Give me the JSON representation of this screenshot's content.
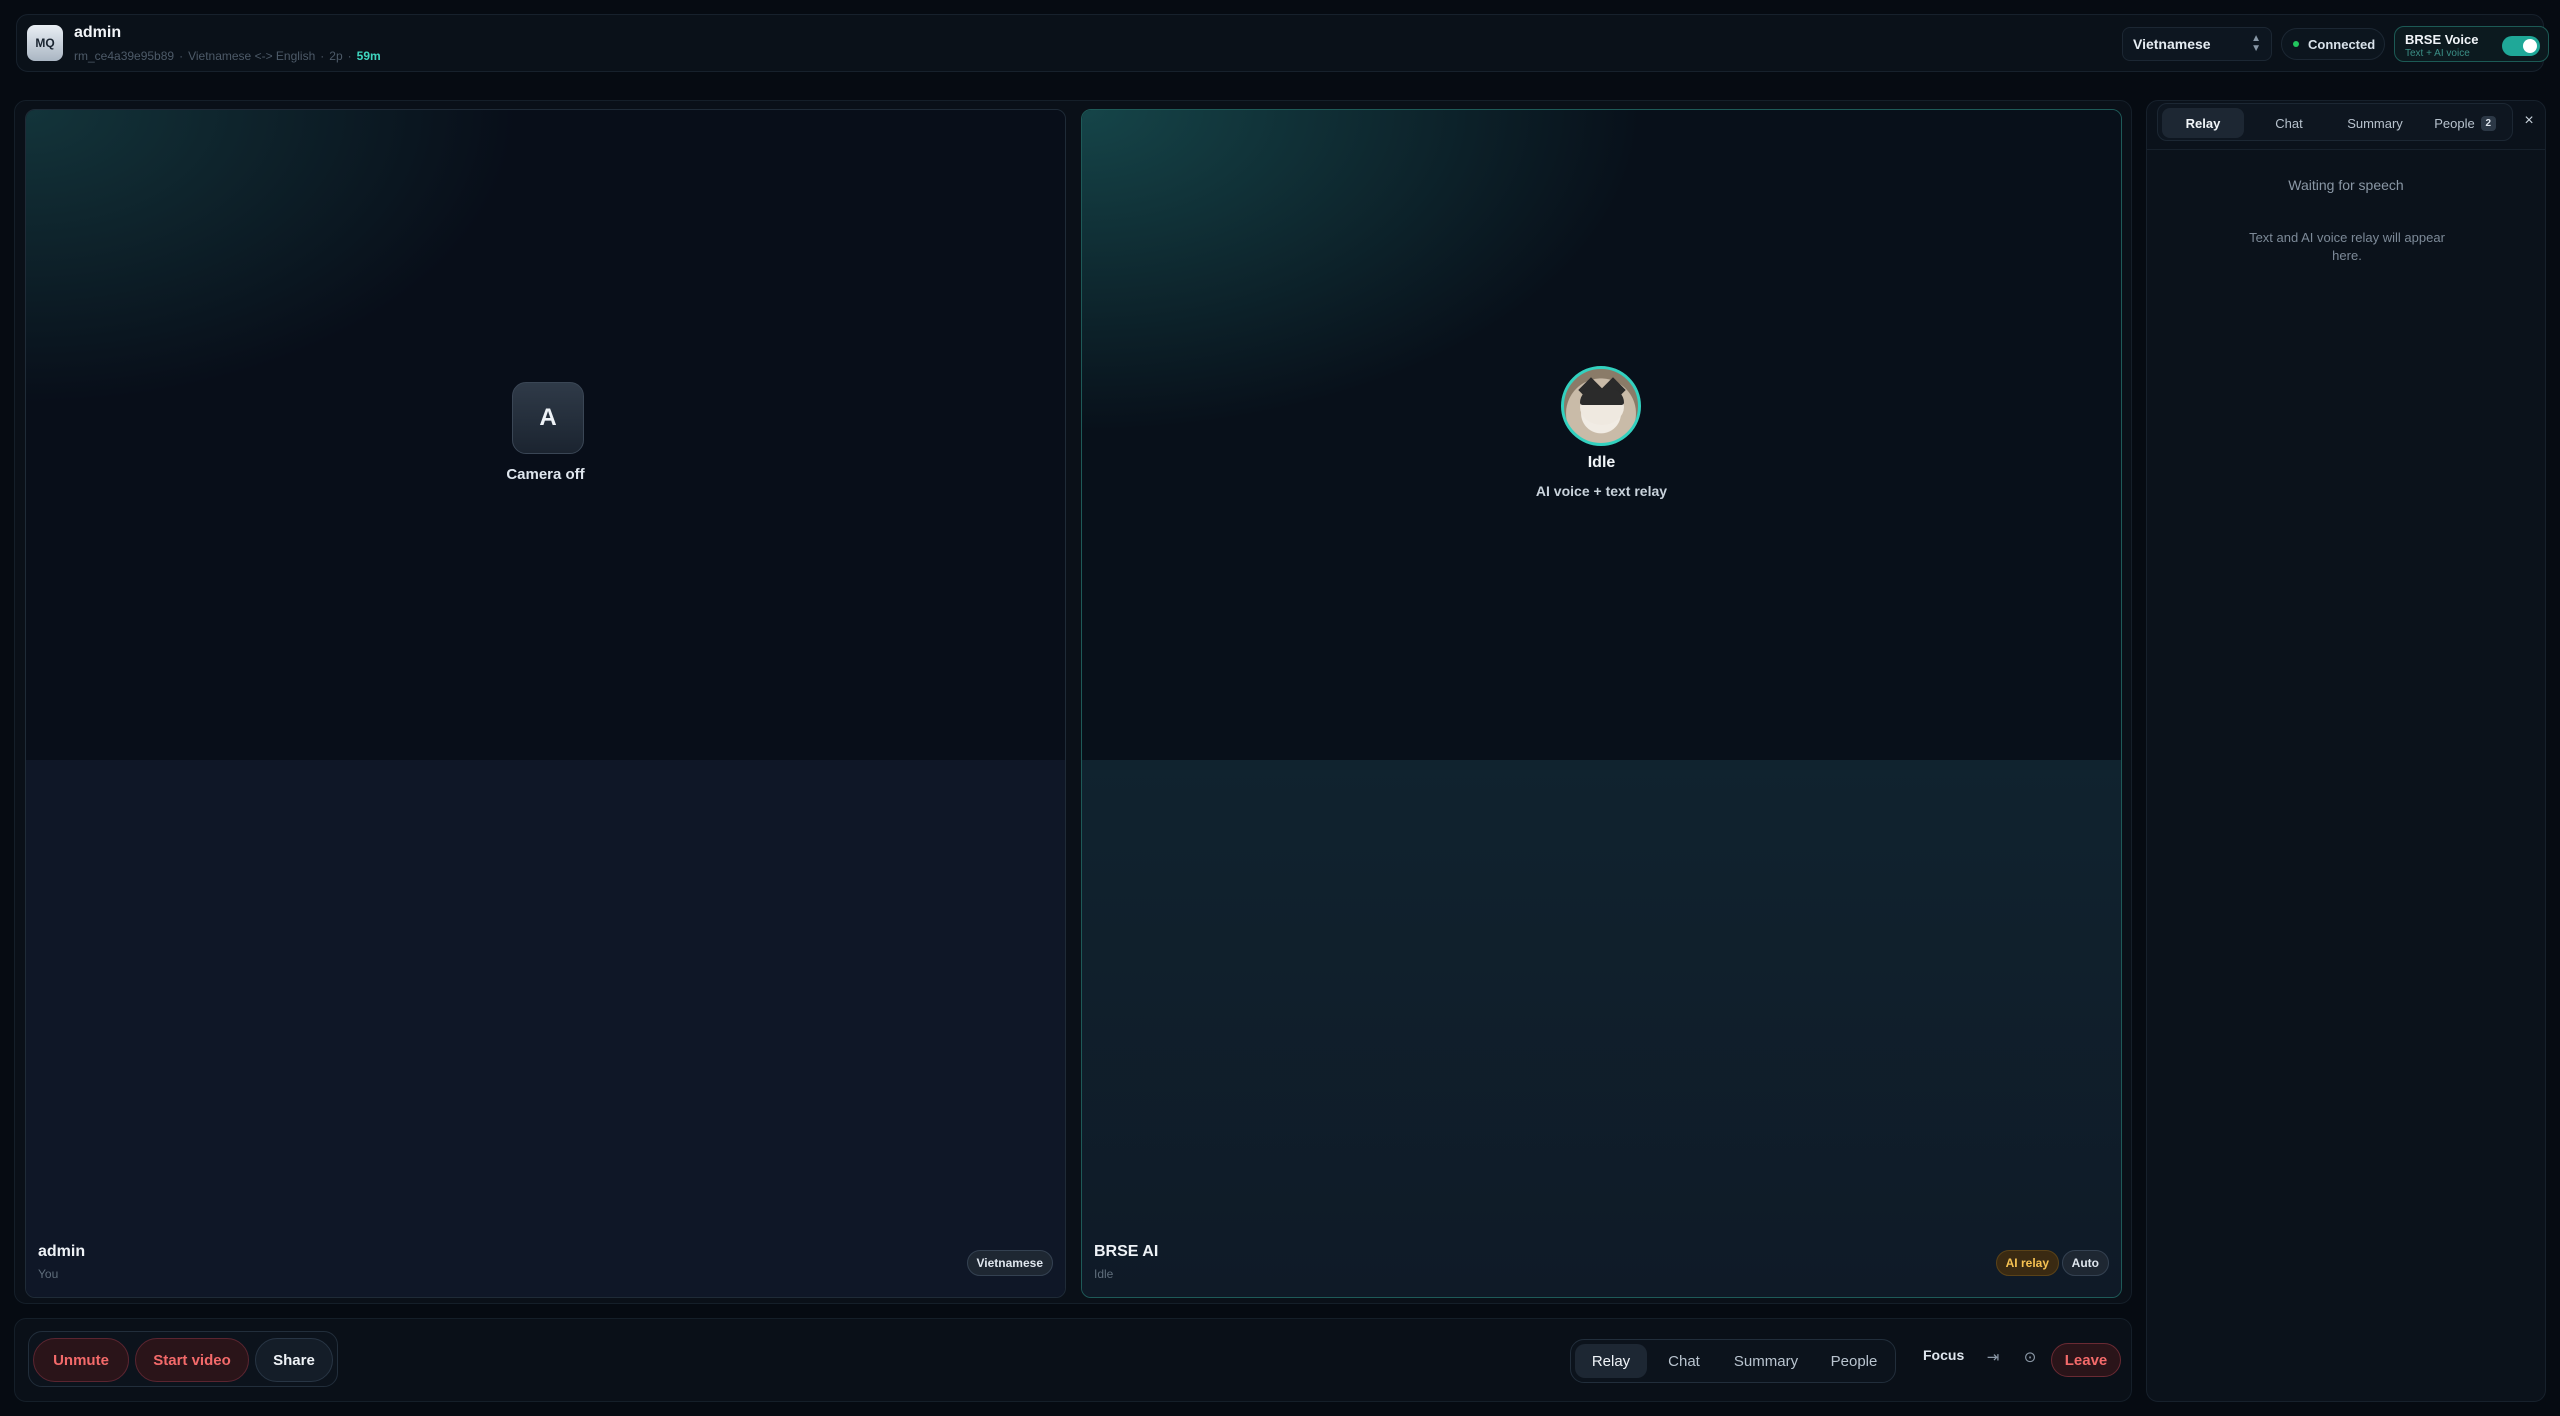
{
  "header": {
    "logo_text": "MQ",
    "title": "admin",
    "meta": {
      "room_id": "rm_ce4a39e95b89",
      "languages": "Vietnamese <-> English",
      "participants": "2p",
      "timer": "59m"
    },
    "language_select": {
      "value": "Vietnamese"
    },
    "connection": {
      "label": "Connected",
      "status_color": "#22c55e"
    },
    "voice": {
      "title": "BRSE Voice",
      "subtitle": "Text + AI voice",
      "enabled": true
    }
  },
  "tiles": [
    {
      "avatar_letter": "A",
      "status": "Camera off",
      "name": "admin",
      "subtitle": "You",
      "badges": [
        "Vietnamese"
      ]
    },
    {
      "status": "Idle",
      "subtitle_center": "AI voice + text relay",
      "name": "BRSE AI",
      "subtitle": "Idle",
      "badges": [
        "AI relay",
        "Auto"
      ]
    }
  ],
  "controls": {
    "unmute": "Unmute",
    "start_video": "Start video",
    "share": "Share",
    "nav": [
      "Relay",
      "Chat",
      "Summary",
      "People"
    ],
    "active_nav": "Relay",
    "focus": "Focus",
    "dock_icon": "⇥",
    "settings_icon": "⊙",
    "leave": "Leave"
  },
  "panel": {
    "tabs": [
      "Relay",
      "Chat",
      "Summary",
      "People"
    ],
    "active_tab": "Relay",
    "people_count": "2",
    "close_icon": "×",
    "empty_title": "Waiting for speech",
    "empty_description": "Text and AI voice relay will appear here."
  },
  "colors": {
    "accent": "#33d1bf",
    "danger": "#f36a6a",
    "relay_badge": "#f6c252"
  }
}
